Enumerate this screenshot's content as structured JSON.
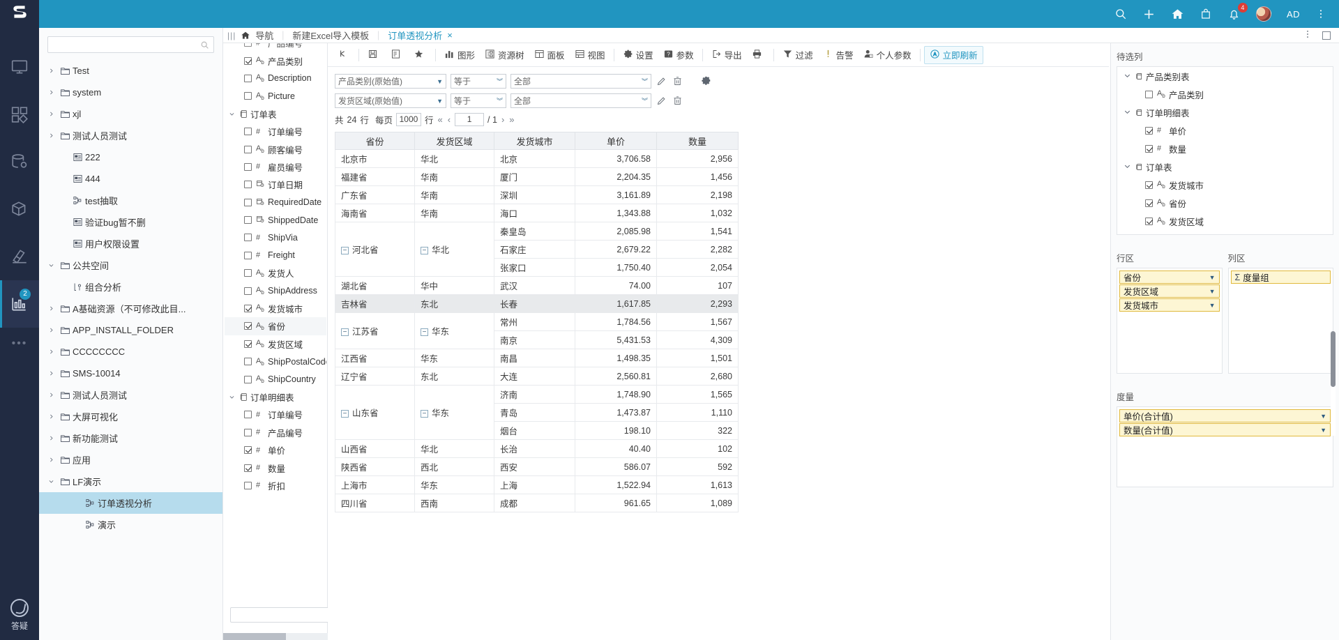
{
  "header": {
    "logo": "s-logo",
    "icons": [
      {
        "name": "search-icon",
        "glyph": "⌕"
      },
      {
        "name": "add-icon",
        "glyph": "+"
      },
      {
        "name": "home-icon",
        "glyph": "home"
      },
      {
        "name": "shop-icon",
        "glyph": "bag"
      },
      {
        "name": "notification-icon",
        "glyph": "bell",
        "badge": "4"
      }
    ],
    "user_initials": "AD",
    "overflow": "more-icon"
  },
  "rail": {
    "items": [
      {
        "name": "monitor",
        "badge": ""
      },
      {
        "name": "apps",
        "badge": ""
      },
      {
        "name": "database",
        "badge": ""
      },
      {
        "name": "package",
        "badge": ""
      },
      {
        "name": "tool",
        "badge": ""
      },
      {
        "name": "analysis",
        "badge": "2",
        "active": true
      }
    ],
    "more": "•••",
    "help_label": "答疑"
  },
  "sidebar": {
    "search_placeholder": "",
    "items": [
      {
        "label": "Test",
        "icon": "folder-icon",
        "arrow": "right",
        "indent": 1
      },
      {
        "label": "system",
        "icon": "folder-icon",
        "arrow": "right",
        "indent": 1
      },
      {
        "label": "xjl",
        "icon": "folder-icon",
        "arrow": "right",
        "indent": 1
      },
      {
        "label": "测试人员测试",
        "icon": "folder-icon",
        "arrow": "right",
        "indent": 1
      },
      {
        "label": "222",
        "icon": "report-icon",
        "arrow": "",
        "indent": 2
      },
      {
        "label": "444",
        "icon": "report-icon",
        "arrow": "",
        "indent": 2
      },
      {
        "label": "test抽取",
        "icon": "flow-icon",
        "arrow": "",
        "indent": 2
      },
      {
        "label": "验证bug暂不删",
        "icon": "report-icon",
        "arrow": "",
        "indent": 2
      },
      {
        "label": "用户权限设置",
        "icon": "report-icon",
        "arrow": "",
        "indent": 2
      },
      {
        "label": "公共空间",
        "icon": "folder-icon",
        "arrow": "down",
        "indent": 0
      },
      {
        "label": "组合分析",
        "icon": "combo-icon",
        "arrow": "",
        "indent": 2
      },
      {
        "label": "A基础资源（不可修改此目...",
        "icon": "folder-icon",
        "arrow": "right",
        "indent": 1
      },
      {
        "label": "APP_INSTALL_FOLDER",
        "icon": "folder-icon",
        "arrow": "right",
        "indent": 1
      },
      {
        "label": "CCCCCCCC",
        "icon": "folder-icon",
        "arrow": "right",
        "indent": 1
      },
      {
        "label": "SMS-10014",
        "icon": "folder-icon",
        "arrow": "right",
        "indent": 1
      },
      {
        "label": "测试人员测试",
        "icon": "folder-icon",
        "arrow": "right",
        "indent": 1
      },
      {
        "label": "大屏可视化",
        "icon": "folder-icon",
        "arrow": "right",
        "indent": 1
      },
      {
        "label": "新功能测试",
        "icon": "folder-icon",
        "arrow": "right",
        "indent": 1
      },
      {
        "label": "应用",
        "icon": "folder-icon",
        "arrow": "right",
        "indent": 1
      },
      {
        "label": "LF演示",
        "icon": "folder-icon",
        "arrow": "down",
        "indent": 1
      },
      {
        "label": "订单透视分析",
        "icon": "flow-icon",
        "arrow": "",
        "indent": 3,
        "selected": true
      },
      {
        "label": "演示",
        "icon": "flow-icon",
        "arrow": "",
        "indent": 3
      }
    ]
  },
  "breadcrumb": {
    "menu_icon": "panel-toggle-icon",
    "home_label": "导航",
    "items": [
      "新建 Excel导入模板"
    ],
    "second_label": "新建Excel导入模板",
    "active_tab": "订单透视分析",
    "close": "×",
    "sep": "｜"
  },
  "field_tree": {
    "rows": [
      {
        "label": "产品编号",
        "type": "#",
        "checked": false,
        "level": 2,
        "clipped": true
      },
      {
        "label": "产品类别",
        "type": "Ab",
        "checked": true,
        "level": 2
      },
      {
        "label": "Description",
        "type": "Ab",
        "checked": false,
        "level": 2
      },
      {
        "label": "Picture",
        "type": "Ab",
        "checked": false,
        "level": 2
      },
      {
        "group": "订单表",
        "level": 1
      },
      {
        "label": "订单编号",
        "type": "#",
        "checked": false,
        "level": 2
      },
      {
        "label": "顾客编号",
        "type": "Ab",
        "checked": false,
        "level": 2
      },
      {
        "label": "雇员编号",
        "type": "#",
        "checked": false,
        "level": 2
      },
      {
        "label": "订单日期",
        "type": "date",
        "checked": false,
        "level": 2
      },
      {
        "label": "RequiredDate",
        "type": "date",
        "checked": false,
        "level": 2
      },
      {
        "label": "ShippedDate",
        "type": "date",
        "checked": false,
        "level": 2
      },
      {
        "label": "ShipVia",
        "type": "#",
        "checked": false,
        "level": 2
      },
      {
        "label": "Freight",
        "type": "#",
        "checked": false,
        "level": 2
      },
      {
        "label": "发货人",
        "type": "Ab",
        "checked": false,
        "level": 2
      },
      {
        "label": "ShipAddress",
        "type": "Ab",
        "checked": false,
        "level": 2
      },
      {
        "label": "发货城市",
        "type": "Ab",
        "checked": true,
        "level": 2
      },
      {
        "label": "省份",
        "type": "Ab",
        "checked": true,
        "level": 2,
        "highlight": true
      },
      {
        "label": "发货区域",
        "type": "Ab",
        "checked": true,
        "level": 2
      },
      {
        "label": "ShipPostalCode",
        "type": "Ab",
        "checked": false,
        "level": 2
      },
      {
        "label": "ShipCountry",
        "type": "Ab",
        "checked": false,
        "level": 2
      },
      {
        "group": "订单明细表",
        "level": 1
      },
      {
        "label": "订单编号",
        "type": "#",
        "checked": false,
        "level": 2
      },
      {
        "label": "产品编号",
        "type": "#",
        "checked": false,
        "level": 2
      },
      {
        "label": "单价",
        "type": "#",
        "checked": true,
        "level": 2
      },
      {
        "label": "数量",
        "type": "#",
        "checked": true,
        "level": 2
      },
      {
        "label": "折扣",
        "type": "#",
        "checked": false,
        "level": 2
      }
    ],
    "search_placeholder": ""
  },
  "toolbar": {
    "buttons": [
      {
        "name": "refresh-button",
        "label": "",
        "icon": "refresh"
      },
      {
        "name": "save-button",
        "label": "",
        "icon": "save"
      },
      {
        "name": "save-as-button",
        "label": "",
        "icon": "saveas"
      },
      {
        "name": "favorite-button",
        "label": "",
        "icon": "star"
      },
      {
        "name": "chart-button",
        "label": "图形",
        "icon": "chart"
      },
      {
        "name": "resource-tree-button",
        "label": "资源树",
        "icon": "tree"
      },
      {
        "name": "panel-button",
        "label": "面板",
        "icon": "panel"
      },
      {
        "name": "view-button",
        "label": "视图",
        "icon": "view"
      },
      {
        "name": "settings-button",
        "label": "设置",
        "icon": "gear"
      },
      {
        "name": "parameter-button",
        "label": "参数",
        "icon": "question"
      },
      {
        "name": "export-button",
        "label": "导出",
        "icon": "export"
      },
      {
        "name": "print-button",
        "label": "",
        "icon": "printer"
      },
      {
        "name": "filter-button",
        "label": "过滤",
        "icon": "funnel"
      },
      {
        "name": "alarm-button",
        "label": "告警",
        "icon": "alert"
      },
      {
        "name": "personal-parameter-button",
        "label": "个人参数",
        "icon": "user"
      },
      {
        "name": "refresh-now-button",
        "label": "立即刷新",
        "icon": "autorefresh",
        "primary": true
      }
    ]
  },
  "filters": {
    "rows": [
      {
        "field": "产品类别(原始值)",
        "op": "等于",
        "value": "全部"
      },
      {
        "field": "发货区域(原始值)",
        "op": "等于",
        "value": "全部"
      }
    ],
    "edit_icon": "pencil-icon",
    "delete_icon": "trash-icon",
    "gear_icon": "gear-icon"
  },
  "pager": {
    "total_prefix": "共",
    "total": "24",
    "row_unit": "行",
    "per_page_label": "每页",
    "page_size": "1000",
    "page_size_unit": "行",
    "current_page": "1",
    "total_pages": "/ 1"
  },
  "chart_data": {
    "type": "table",
    "title": "订单透视分析",
    "columns": [
      "省份",
      "发货区域",
      "发货城市",
      "单价",
      "数量"
    ],
    "rows": [
      {
        "province": "北京市",
        "region": "华北",
        "city": "北京",
        "price": "3,706.58",
        "qty": "2,956"
      },
      {
        "province": "福建省",
        "region": "华南",
        "city": "厦门",
        "price": "2,204.35",
        "qty": "1,456"
      },
      {
        "province": "广东省",
        "region": "华南",
        "city": "深圳",
        "price": "3,161.89",
        "qty": "2,198"
      },
      {
        "province": "海南省",
        "region": "华南",
        "city": "海口",
        "price": "1,343.88",
        "qty": "1,032"
      },
      {
        "province": "河北省",
        "region": "华北",
        "city": "秦皇岛",
        "price": "2,085.98",
        "qty": "1,541",
        "expandable": true,
        "rowspan": 3
      },
      {
        "province": "",
        "region": "",
        "city": "石家庄",
        "price": "2,679.22",
        "qty": "2,282"
      },
      {
        "province": "",
        "region": "",
        "city": "张家口",
        "price": "1,750.40",
        "qty": "2,054"
      },
      {
        "province": "湖北省",
        "region": "华中",
        "city": "武汉",
        "price": "74.00",
        "qty": "107"
      },
      {
        "province": "吉林省",
        "region": "东北",
        "city": "长春",
        "price": "1,617.85",
        "qty": "2,293",
        "hover": true
      },
      {
        "province": "江苏省",
        "region": "华东",
        "city": "常州",
        "price": "1,784.56",
        "qty": "1,567",
        "expandable": true,
        "rowspan": 2
      },
      {
        "province": "",
        "region": "",
        "city": "南京",
        "price": "5,431.53",
        "qty": "4,309"
      },
      {
        "province": "江西省",
        "region": "华东",
        "city": "南昌",
        "price": "1,498.35",
        "qty": "1,501"
      },
      {
        "province": "辽宁省",
        "region": "东北",
        "city": "大连",
        "price": "2,560.81",
        "qty": "2,680"
      },
      {
        "province": "山东省",
        "region": "华东",
        "city": "济南",
        "price": "1,748.90",
        "qty": "1,565",
        "expandable": true,
        "rowspan": 3
      },
      {
        "province": "",
        "region": "",
        "city": "青岛",
        "price": "1,473.87",
        "qty": "1,110"
      },
      {
        "province": "",
        "region": "",
        "city": "烟台",
        "price": "198.10",
        "qty": "322"
      },
      {
        "province": "山西省",
        "region": "华北",
        "city": "长治",
        "price": "40.40",
        "qty": "102"
      },
      {
        "province": "陕西省",
        "region": "西北",
        "city": "西安",
        "price": "586.07",
        "qty": "592"
      },
      {
        "province": "上海市",
        "region": "华东",
        "city": "上海",
        "price": "1,522.94",
        "qty": "1,613"
      },
      {
        "province": "四川省",
        "region": "西南",
        "city": "成都",
        "price": "961.65",
        "qty": "1,089"
      }
    ],
    "xlabel": "",
    "ylabel": ""
  },
  "right_panel": {
    "available_label": "待选列",
    "available_items": [
      {
        "group": "产品类别表",
        "level": 0
      },
      {
        "label": "产品类别",
        "type": "Ab",
        "checked": false,
        "level": 1
      },
      {
        "group": "订单明细表",
        "level": 0
      },
      {
        "label": "单价",
        "type": "#",
        "checked": true,
        "level": 1
      },
      {
        "label": "数量",
        "type": "#",
        "checked": true,
        "level": 1
      },
      {
        "group": "订单表",
        "level": 0
      },
      {
        "label": "发货城市",
        "type": "Ab",
        "checked": true,
        "level": 1
      },
      {
        "label": "省份",
        "type": "Ab",
        "checked": true,
        "level": 1
      },
      {
        "label": "发货区域",
        "type": "Ab",
        "checked": true,
        "level": 1
      }
    ],
    "row_zone_label": "行区",
    "row_zone_items": [
      "省份",
      "发货区域",
      "发货城市"
    ],
    "col_zone_label": "列区",
    "col_zone_items": [
      "度量组"
    ],
    "col_zone_sigma": "Σ",
    "measure_label": "度量",
    "measure_items": [
      "单价(合计值)",
      "数量(合计值)"
    ]
  },
  "colors": {
    "brand": "#2195c0",
    "rail_bg": "#212b42",
    "accent_chip_border": "#e0b93c",
    "accent_chip_bg": "#fdf6d4",
    "badge_red": "#e8392f"
  }
}
